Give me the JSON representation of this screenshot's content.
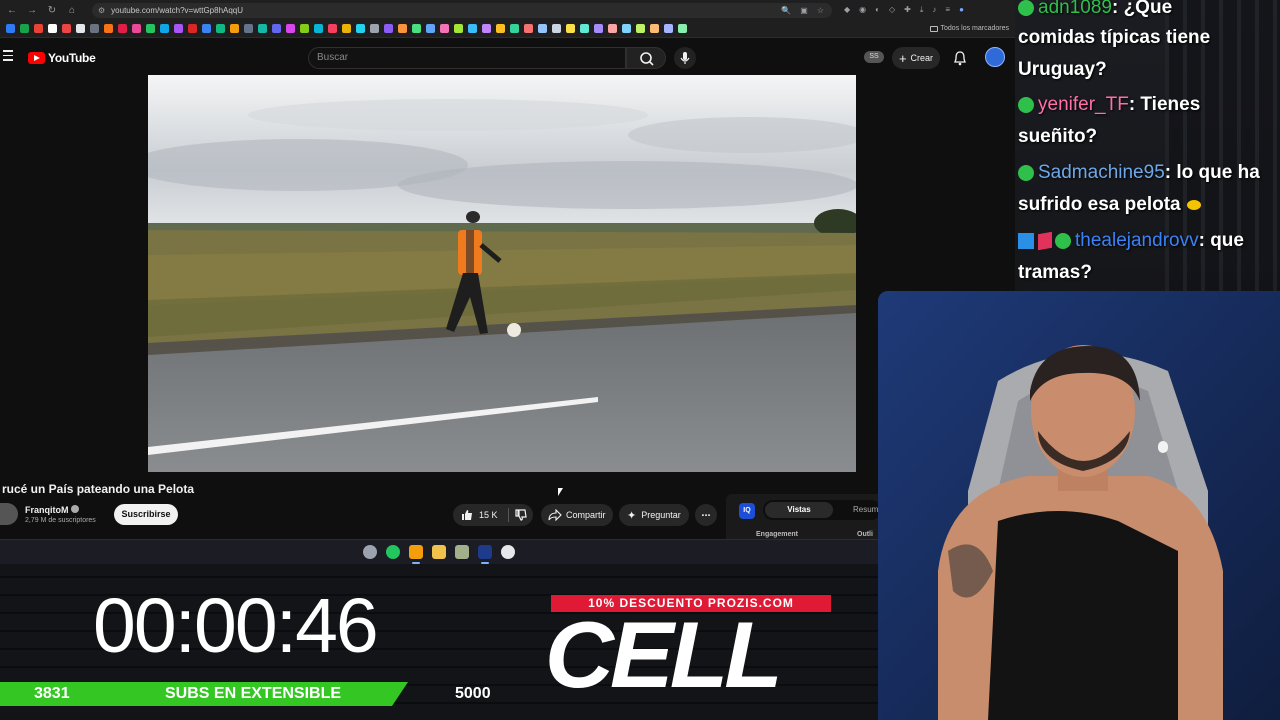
{
  "browser": {
    "url": "youtube.com/watch?v=wttGp8hAqqU",
    "bookmarks_all": "Todos los marcadores",
    "bookmark_colors": [
      "#2d7cf6",
      "#16a34a",
      "#ea4335",
      "#ffffff",
      "#ef4444",
      "#e5e7eb",
      "#6b7280",
      "#f97316",
      "#e11d48",
      "#ec4899",
      "#22c55e",
      "#0ea5e9",
      "#a855f7",
      "#dc2626",
      "#3b82f6",
      "#10b981",
      "#f59e0b",
      "#64748b",
      "#14b8a6",
      "#6366f1",
      "#d946ef",
      "#84cc16",
      "#06b6d4",
      "#f43f5e",
      "#eab308",
      "#22d3ee",
      "#9ca3af",
      "#8b5cf6",
      "#fb923c",
      "#4ade80",
      "#60a5fa",
      "#f472b6",
      "#a3e635",
      "#38bdf8",
      "#c084fc",
      "#fbbf24",
      "#34d399",
      "#f87171",
      "#93c5fd",
      "#cbd5e1",
      "#fde047",
      "#5eead4",
      "#a78bfa",
      "#fca5a5",
      "#7dd3fc",
      "#bef264",
      "#fdba74",
      "#a5b4fc",
      "#86efac"
    ]
  },
  "youtube": {
    "logo_text": "YouTube",
    "search_placeholder": "Buscar",
    "ss_badge": "SS",
    "create_label": "Crear",
    "video": {
      "title": "rucé un País pateando una Pelota",
      "channel": "FranqitoM",
      "subscribers": "2,79 M de suscriptores",
      "subscribe_label": "Suscribirse",
      "likes": "15 K",
      "share_label": "Compartir",
      "ask_label": "Preguntar",
      "more_label": "..."
    },
    "vidiq": {
      "logo": "IQ",
      "tab_active": "Vistas",
      "tab_other": "Resum",
      "label_left": "Engagement",
      "label_right": "Outli"
    }
  },
  "taskbar": {
    "icon_colors": [
      "#9ca3af",
      "#22c55e",
      "#f59e0b",
      "#f0c24b",
      "#a3b18a",
      "#1e3a8a",
      "#e5e7eb"
    ],
    "icon_names": [
      "steam-icon",
      "xbox-icon",
      "chrome-icon",
      "file-explorer-icon",
      "minecraft-icon",
      "photoshop-icon",
      "paint-icon"
    ]
  },
  "overlay": {
    "timer": "00:00:46",
    "subs_current": "3831",
    "subs_label": "SUBS EN EXTENSIBLE",
    "subs_goal": "5000",
    "subs_progress": 0.766,
    "promo_banner": "10% DESCUENTO PROZIS.COM",
    "promo_logo": "CELL",
    "colors": {
      "subs_bar": "#34c724",
      "promo_red": "#e01934"
    }
  },
  "chat": {
    "messages": [
      {
        "user": "adn1089",
        "text": ": ¿Que",
        "user_color": "#2fbf4b"
      },
      {
        "user": "",
        "text": "comidas típicas tiene",
        "user_color": ""
      },
      {
        "user": "",
        "text": "Uruguay?",
        "user_color": ""
      },
      {
        "user": "yenifer_TF",
        "text": ": Tienes",
        "user_color": "#ff6fa8"
      },
      {
        "user": "",
        "text": "sueñito?",
        "user_color": ""
      },
      {
        "user": "Sadmachine95",
        "text": ": lo que ha",
        "user_color": "#6ea8e8"
      },
      {
        "user": "",
        "text": "sufrido esa pelota",
        "user_color": ""
      },
      {
        "user": "thealejandrovv",
        "text": ": que",
        "user_color": "#3b82f6"
      },
      {
        "user": "",
        "text": "tramas?",
        "user_color": ""
      }
    ]
  }
}
